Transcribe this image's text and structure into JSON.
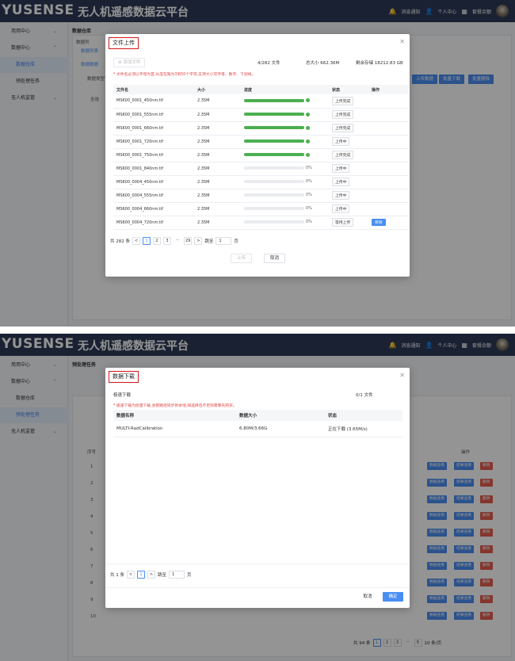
{
  "brand": {
    "logo": "YUSENSE",
    "title": "无人机遥感数据云平台"
  },
  "top_links": {
    "notify": "消息通知",
    "profile": "个人中心",
    "balance": "套餐余额"
  },
  "panel1": {
    "sidebar": [
      {
        "label": "用用中心",
        "chev": "⌄"
      },
      {
        "label": "数据中心",
        "chev": "⌃"
      },
      {
        "label": "数据仓库"
      },
      {
        "label": "预处理任务"
      },
      {
        "label": "无人机监管",
        "chev": "⌄"
      }
    ],
    "crumb": "数据仓库",
    "bg_texts": [
      "数据列",
      "数据列表",
      "数据数据",
      "数据类型",
      "全选"
    ],
    "bg_buttons": [
      "上传数据",
      "批量下载",
      "批量删除"
    ],
    "modal": {
      "title": "文件上传",
      "add_button": "添加文件",
      "count": "4/282 文件",
      "total": "总大小 662.36M",
      "remain": "剩余存储 18212.83 GB",
      "tip": "* 文件名必须以字母为首,长度在限为3到50个字符,支持大小写字母、数字、下划线。",
      "columns": [
        "文件名",
        "大小",
        "进度",
        "状态",
        "操作"
      ],
      "rows": [
        {
          "name": "MS600_0001_450nm.tif",
          "size": "2.35M",
          "progress": 100,
          "status": "上传完成",
          "action": ""
        },
        {
          "name": "MS600_0001_555nm.tif",
          "size": "2.35M",
          "progress": 100,
          "status": "上传完成",
          "action": ""
        },
        {
          "name": "MS600_0001_660nm.tif",
          "size": "2.35M",
          "progress": 100,
          "status": "上传完成",
          "action": ""
        },
        {
          "name": "MS600_0001_720nm.tif",
          "size": "2.35M",
          "progress": 100,
          "status": "上传中",
          "action": ""
        },
        {
          "name": "MS600_0001_750nm.tif",
          "size": "2.35M",
          "progress": 100,
          "status": "上传完成",
          "action": ""
        },
        {
          "name": "MS600_0001_840nm.tif",
          "size": "2.35M",
          "progress": 0,
          "pct": "0%",
          "status": "上传中",
          "action": ""
        },
        {
          "name": "MS600_0004_450nm.tif",
          "size": "2.35M",
          "progress": 0,
          "pct": "0%",
          "status": "上传中",
          "action": ""
        },
        {
          "name": "MS600_0004_555nm.tif",
          "size": "2.35M",
          "progress": 0,
          "pct": "0%",
          "status": "上传中",
          "action": ""
        },
        {
          "name": "MS600_0004_660nm.tif",
          "size": "2.35M",
          "progress": 0,
          "pct": "0%",
          "status": "上传中",
          "action": ""
        },
        {
          "name": "MS600_0004_720nm.tif",
          "size": "2.35M",
          "progress": 0,
          "pct": "0%",
          "status": "等待上传",
          "action": "移除"
        }
      ],
      "pager": {
        "total": "共 282 条",
        "prev": "<",
        "pages": [
          "1",
          "2",
          "3",
          "···",
          "29"
        ],
        "next": ">",
        "jump": "跳至",
        "jump_value": "1",
        "page_unit": "页"
      },
      "upload_button": "上传",
      "cancel_button": "取消"
    }
  },
  "panel2": {
    "sidebar": [
      {
        "label": "用用中心",
        "chev": "⌄"
      },
      {
        "label": "数据中心",
        "chev": "⌃"
      },
      {
        "label": "数据仓库"
      },
      {
        "label": "预处理任务"
      },
      {
        "label": "无人机监管",
        "chev": "⌄"
      }
    ],
    "crumb": "预处理任务",
    "bg_col_header": "序号",
    "bg_op_header": "操作",
    "bg_row_nums": [
      "1",
      "2",
      "3",
      "4",
      "5",
      "6",
      "7",
      "8",
      "9",
      "10"
    ],
    "bg_op_buttons": [
      "数据查看",
      "结果查看",
      "删除"
    ],
    "bg_pager": {
      "total": "共 94 条",
      "pages": [
        "1",
        "2",
        "3",
        "···",
        "5"
      ],
      "size": "10 条/页"
    },
    "modal": {
      "title": "数据下载",
      "speed_label": "极速下载",
      "count": "0/1 文件",
      "tip": "* 极速下载为批量下载,会把路径同步到本地,如选择包不足则需要先购买。",
      "columns": [
        "数据名称",
        "数据大小",
        "状态"
      ],
      "rows": [
        {
          "name": "MULTI-RadCalibration",
          "size": "6.80M/3.66G",
          "status": "正在下载 (3.65M/s)"
        }
      ],
      "pager": {
        "total": "共 1 条",
        "prev": "<",
        "page": "1",
        "next": ">",
        "jump": "跳至",
        "jump_value": "1",
        "page_unit": "页"
      },
      "cancel_button": "取消",
      "ok_button": "确定"
    }
  },
  "colors": {
    "topbar": "#2e3a57",
    "accent": "#4a8ef2",
    "progress": "#4caf50",
    "highlight": "#d4161c",
    "tip": "#e04545"
  }
}
